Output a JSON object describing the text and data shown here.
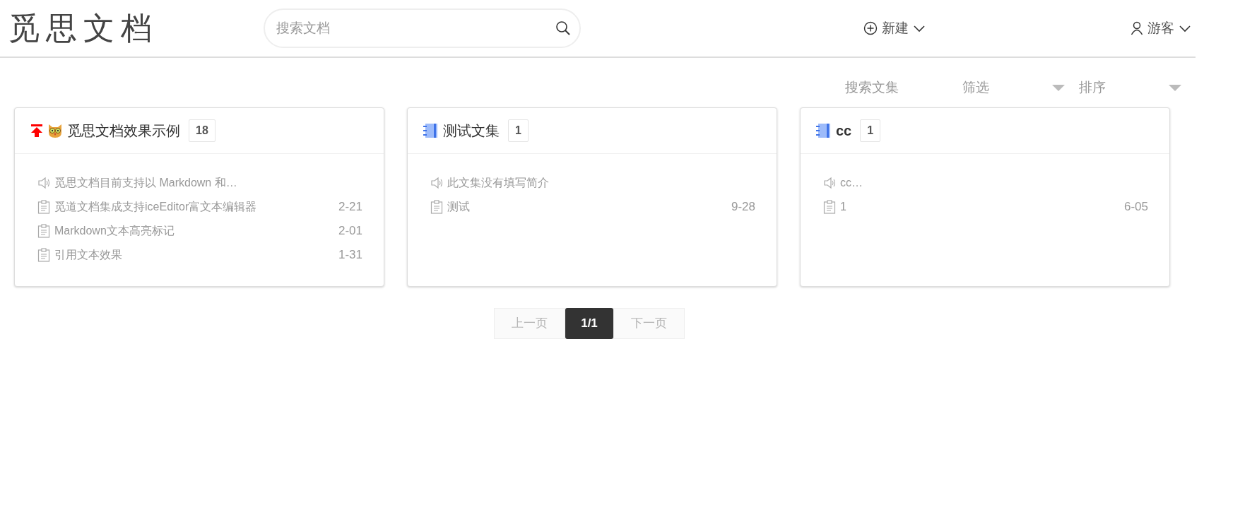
{
  "header": {
    "logo": "觅思文档",
    "search": {
      "placeholder": "搜索文档"
    },
    "new_menu": "新建",
    "user_menu": "游客"
  },
  "toolbar": {
    "search_collections": "搜索文集",
    "filter": "筛选",
    "sort": "排序"
  },
  "collections": [
    {
      "title": "觅思文档效果示例",
      "kind": "emoji",
      "pinned": true,
      "bold": false,
      "count": "18",
      "items": [
        {
          "kind": "intro",
          "text": "觅思文档目前支持以 Markdown 和…"
        },
        {
          "kind": "doc",
          "text": "觅道文档集成支持iceEditor富文本编辑器",
          "date": "2-21"
        },
        {
          "kind": "doc",
          "text": "Markdown文本高亮标记",
          "date": "2-01"
        },
        {
          "kind": "doc",
          "text": "引用文本效果",
          "date": "1-31"
        }
      ]
    },
    {
      "title": "测试文集",
      "kind": "notebook",
      "pinned": false,
      "bold": false,
      "count": "1",
      "items": [
        {
          "kind": "intro",
          "text": "此文集没有填写简介"
        },
        {
          "kind": "doc",
          "text": "测试",
          "date": "9-28"
        }
      ]
    },
    {
      "title": "cc",
      "kind": "notebook",
      "pinned": false,
      "bold": true,
      "count": "1",
      "items": [
        {
          "kind": "intro",
          "text": "cc…"
        },
        {
          "kind": "doc",
          "text": "1",
          "date": "6-05"
        }
      ]
    }
  ],
  "pagination": {
    "previous": {
      "label": "上一页",
      "disabled": true
    },
    "current": "1/1",
    "next": {
      "label": "下一页",
      "disabled": true
    }
  }
}
